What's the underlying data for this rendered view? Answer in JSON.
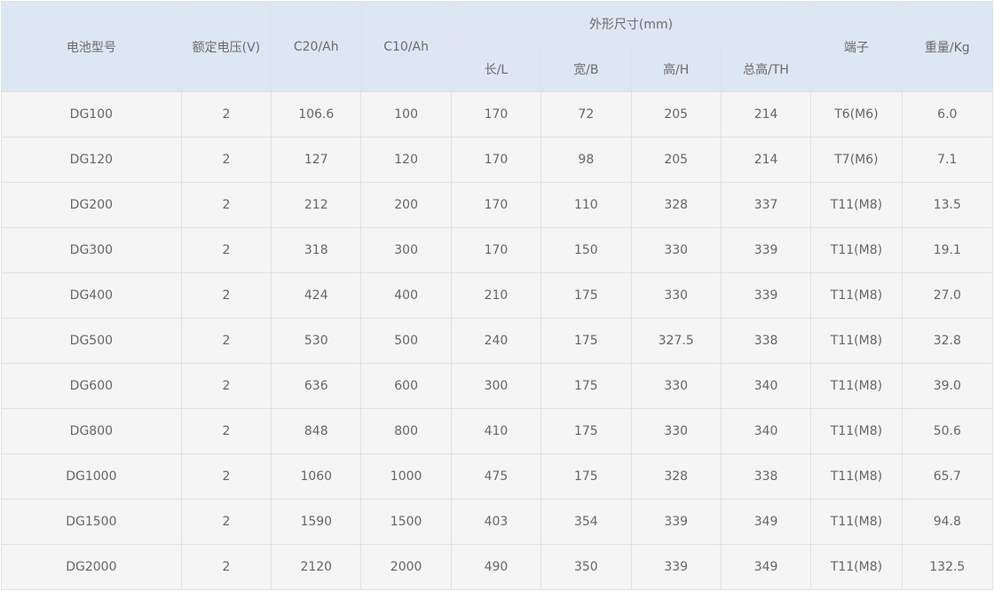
{
  "table": {
    "headers": {
      "model": "电池型号",
      "voltage": "额定电压(V)",
      "c20": "C20/Ah",
      "c10": "C10/Ah",
      "dimensions": "外形尺寸(mm)",
      "length": "长/L",
      "width": "宽/B",
      "height": "高/H",
      "total_height": "总高/TH",
      "terminal": "端子",
      "weight": "重量/Kg"
    },
    "rows": [
      [
        "DG100",
        "2",
        "106.6",
        "100",
        "170",
        "72",
        "205",
        "214",
        "T6(M6)",
        "6.0"
      ],
      [
        "DG120",
        "2",
        "127",
        "120",
        "170",
        "98",
        "205",
        "214",
        "T7(M6)",
        "7.1"
      ],
      [
        "DG200",
        "2",
        "212",
        "200",
        "170",
        "110",
        "328",
        "337",
        "T11(M8)",
        "13.5"
      ],
      [
        "DG300",
        "2",
        "318",
        "300",
        "170",
        "150",
        "330",
        "339",
        "T11(M8)",
        "19.1"
      ],
      [
        "DG400",
        "2",
        "424",
        "400",
        "210",
        "175",
        "330",
        "339",
        "T11(M8)",
        "27.0"
      ],
      [
        "DG500",
        "2",
        "530",
        "500",
        "240",
        "175",
        "327.5",
        "338",
        "T11(M8)",
        "32.8"
      ],
      [
        "DG600",
        "2",
        "636",
        "600",
        "300",
        "175",
        "330",
        "340",
        "T11(M8)",
        "39.0"
      ],
      [
        "DG800",
        "2",
        "848",
        "800",
        "410",
        "175",
        "330",
        "340",
        "T11(M8)",
        "50.6"
      ],
      [
        "DG1000",
        "2",
        "1060",
        "1000",
        "475",
        "175",
        "328",
        "338",
        "T11(M8)",
        "65.7"
      ],
      [
        "DG1500",
        "2",
        "1590",
        "1500",
        "403",
        "354",
        "339",
        "349",
        "T11(M8)",
        "94.8"
      ],
      [
        "DG2000",
        "2",
        "2120",
        "2000",
        "490",
        "350",
        "339",
        "349",
        "T11(M8)",
        "132.5"
      ]
    ]
  },
  "colors": {
    "header_bg": "#dde6f3",
    "cell_bg": "#f5f5f5",
    "border": "#e2e2e2",
    "text": "#666666"
  }
}
